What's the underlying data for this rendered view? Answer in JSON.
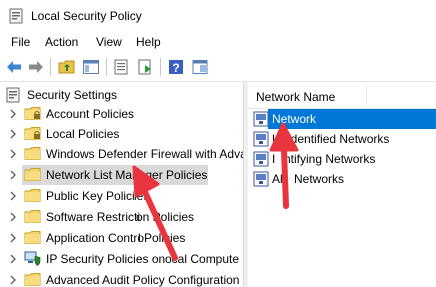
{
  "window": {
    "title": "Local Security Policy"
  },
  "menu": [
    {
      "label": "File"
    },
    {
      "label": "Action"
    },
    {
      "label": "View"
    },
    {
      "label": "Help"
    }
  ],
  "tree": {
    "root": "Security Settings",
    "items": [
      {
        "label": "Account Policies",
        "icon": "folder-lock-icon"
      },
      {
        "label": "Local Policies",
        "icon": "folder-lock-icon"
      },
      {
        "label": "Windows Defender Firewall with Adva",
        "icon": "folder-icon"
      },
      {
        "label": "Network List Manager Policies",
        "icon": "folder-icon",
        "selected": true
      },
      {
        "label": "Public Key Polici",
        "icon": "folder-icon"
      },
      {
        "label": "Software Restricti",
        "icon": "folder-icon"
      },
      {
        "label": "Application Contro",
        "icon": "folder-icon"
      },
      {
        "label": "IP Security Policies on",
        "icon": "shield-computer-icon"
      },
      {
        "label": "Advanced Audit Policy Configuration",
        "icon": "folder-icon"
      }
    ]
  },
  "tree_partial_text": [
    "ies",
    "on Policies",
    "l Policies",
    "ocal Compute"
  ],
  "list": {
    "column": "Network Name",
    "items": [
      {
        "label": "Network",
        "selected": true
      },
      {
        "label": "U",
        "tail": "identified Networks"
      },
      {
        "label": "I",
        "tail": "ntifying Networks"
      },
      {
        "label": "Al",
        "tail": "Networks"
      }
    ]
  },
  "colors": {
    "selection": "#0078d7",
    "tree_selection": "#d9d9d9",
    "annotation_arrow": "#e8353e"
  }
}
